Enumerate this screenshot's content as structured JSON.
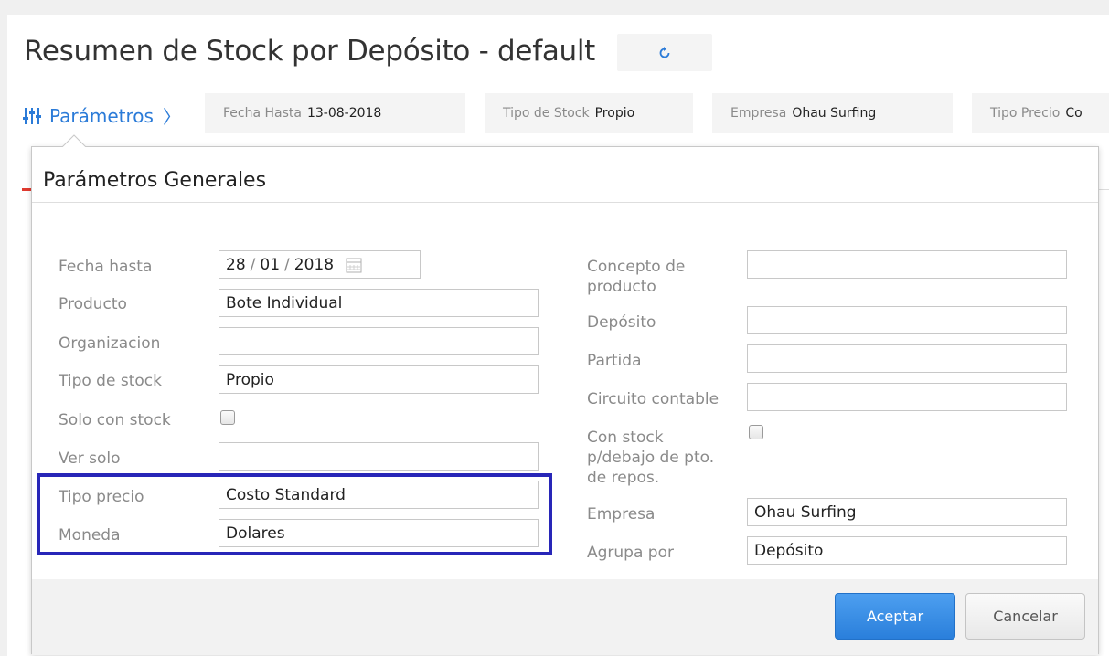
{
  "page": {
    "title": "Resumen de Stock por Depósito - default",
    "refresh_icon": "refresh-icon"
  },
  "params_bar": {
    "toggle_label": "Parámetros",
    "toggle_icon": "sliders-icon",
    "chevron": "〉",
    "chips": [
      {
        "label": "Fecha Hasta",
        "value": "13-08-2018"
      },
      {
        "label": "Tipo de Stock",
        "value": "Propio"
      },
      {
        "label": "Empresa",
        "value": "Ohau Surfing"
      },
      {
        "label": "Tipo Precio",
        "value": "Co"
      }
    ]
  },
  "dialog": {
    "title": "Parámetros Generales",
    "left": {
      "fecha_hasta": {
        "label": "Fecha hasta",
        "day": "28",
        "month": "01",
        "year": "2018",
        "separator": "/"
      },
      "producto": {
        "label": "Producto",
        "value": "Bote Individual"
      },
      "organizacion": {
        "label": "Organizacion",
        "value": ""
      },
      "tipo_stock": {
        "label": "Tipo de stock",
        "value": "Propio"
      },
      "solo_con_stock": {
        "label": "Solo con stock",
        "checked": false
      },
      "ver_solo": {
        "label": "Ver solo",
        "value": ""
      },
      "tipo_precio": {
        "label": "Tipo precio",
        "value": "Costo Standard"
      },
      "moneda": {
        "label": "Moneda",
        "value": "Dolares"
      }
    },
    "right": {
      "concepto": {
        "label_line1": "Concepto de",
        "label_line2": "producto",
        "value": ""
      },
      "deposito": {
        "label": "Depósito",
        "value": ""
      },
      "partida": {
        "label": "Partida",
        "value": ""
      },
      "circuito": {
        "label": "Circuito contable",
        "value": ""
      },
      "con_stock": {
        "label_line1": "Con stock",
        "label_line2": "p/debajo de pto.",
        "label_line3": "de repos.",
        "checked": false
      },
      "empresa": {
        "label": "Empresa",
        "value": "Ohau Surfing"
      },
      "agrupa_por": {
        "label": "Agrupa por",
        "value": "Depósito"
      }
    },
    "buttons": {
      "accept": "Aceptar",
      "cancel": "Cancelar"
    }
  },
  "colors": {
    "accent_blue": "#2b7bd8",
    "highlight_border": "#2826b8",
    "accept_button": "#3a8fe6",
    "red_accent": "#e03a2f"
  }
}
